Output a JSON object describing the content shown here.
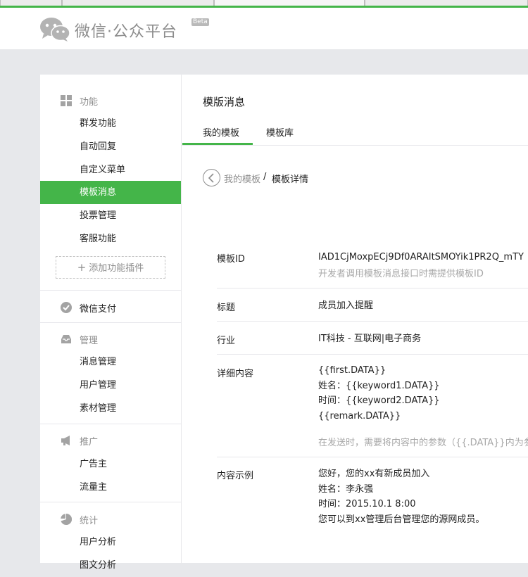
{
  "brand": {
    "name": "微信·公众平台",
    "badge": "Beta"
  },
  "sidebar": {
    "sections": [
      {
        "title": "功能",
        "icon": "grid-icon",
        "items": [
          "群发功能",
          "自动回复",
          "自定义菜单",
          "模板消息",
          "投票管理",
          "客服功能"
        ],
        "active": "模板消息",
        "add_plugin": "添加功能插件"
      },
      {
        "title": "微信支付",
        "icon": "wechat-pay-icon",
        "items": []
      },
      {
        "title": "管理",
        "icon": "inbox-icon",
        "items": [
          "消息管理",
          "用户管理",
          "素材管理"
        ]
      },
      {
        "title": "推广",
        "icon": "megaphone-icon",
        "items": [
          "广告主",
          "流量主"
        ]
      },
      {
        "title": "统计",
        "icon": "pie-chart-icon",
        "items": [
          "用户分析",
          "图文分析"
        ]
      }
    ]
  },
  "main": {
    "title": "模版消息",
    "tabs": [
      "我的模板",
      "模板库"
    ],
    "active_tab": "我的模板",
    "breadcrumb": {
      "link": "我的模板",
      "separator": "/",
      "current": "模板详情"
    },
    "detail": {
      "template_id_label": "模板ID",
      "template_id_value": "IAD1CjMoxpECj9Df0ARAItSMOYik1PR2Q_mTY",
      "template_id_hint": "开发者调用模板消息接口时需提供模板ID",
      "title_label": "标题",
      "title_value": "成员加入提醒",
      "industry_label": "行业",
      "industry_value": "IT科技 - 互联网|电子商务",
      "content_label": "详细内容",
      "content_lines": [
        "{{first.DATA}}",
        "姓名：{{keyword1.DATA}}",
        "时间：{{keyword2.DATA}}",
        "{{remark.DATA}}"
      ],
      "content_hint": "在发送时，需要将内容中的参数（{{.DATA}}内为参",
      "example_label": "内容示例",
      "example_lines": [
        "您好，您的xx有新成员加入",
        "姓名：李永强",
        "时间：2015.10.1 8:00",
        "您可以到xx管理后台管理您的源网成员。"
      ]
    }
  },
  "colors": {
    "accent": "#44b549",
    "muted": "#8d8d8d",
    "border": "#e7e7eb",
    "background": "#e7e8eb"
  }
}
